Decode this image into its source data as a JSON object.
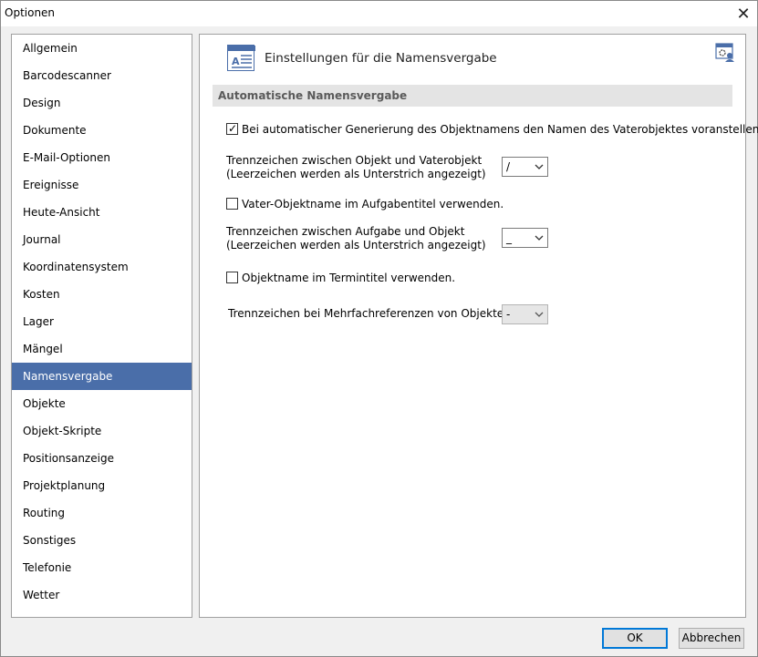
{
  "window": {
    "title": "Optionen",
    "close_label": "✕"
  },
  "sidebar": {
    "items": [
      {
        "label": "Allgemein",
        "selected": false
      },
      {
        "label": "Barcodescanner",
        "selected": false
      },
      {
        "label": "Design",
        "selected": false
      },
      {
        "label": "Dokumente",
        "selected": false
      },
      {
        "label": "E-Mail-Optionen",
        "selected": false
      },
      {
        "label": "Ereignisse",
        "selected": false
      },
      {
        "label": "Heute-Ansicht",
        "selected": false
      },
      {
        "label": "Journal",
        "selected": false
      },
      {
        "label": "Koordinatensystem",
        "selected": false
      },
      {
        "label": "Kosten",
        "selected": false
      },
      {
        "label": "Lager",
        "selected": false
      },
      {
        "label": "Mängel",
        "selected": false
      },
      {
        "label": "Namensvergabe",
        "selected": true
      },
      {
        "label": "Objekte",
        "selected": false
      },
      {
        "label": "Objekt-Skripte",
        "selected": false
      },
      {
        "label": "Positionsanzeige",
        "selected": false
      },
      {
        "label": "Projektplanung",
        "selected": false
      },
      {
        "label": "Routing",
        "selected": false
      },
      {
        "label": "Sonstiges",
        "selected": false
      },
      {
        "label": "Telefonie",
        "selected": false
      },
      {
        "label": "Wetter",
        "selected": false
      }
    ]
  },
  "content": {
    "header_title": "Einstellungen für die Namensvergabe",
    "header_icon": "settings-page-icon",
    "corner_icon": "user-settings-icon",
    "section_title": "Automatische Namensvergabe",
    "option_prepend_parent": {
      "label": "Bei automatischer Generierung des Objektnamens den Namen des Vaterobjektes voranstellen.",
      "checked": true
    },
    "separator_object_parent": {
      "line1": "Trennzeichen zwischen Objekt und Vaterobjekt",
      "line2": "(Leerzeichen werden als Unterstrich angezeigt)",
      "value": "/"
    },
    "option_parent_in_task": {
      "label": "Vater-Objektname im Aufgabentitel verwenden.",
      "checked": false
    },
    "separator_task_object": {
      "line1": "Trennzeichen zwischen Aufgabe und Objekt",
      "line2": "(Leerzeichen werden als Unterstrich angezeigt)",
      "value": "_"
    },
    "option_object_in_appointment": {
      "label": "Objektname im Termintitel verwenden.",
      "checked": false
    },
    "separator_multi_ref": {
      "label": "Trennzeichen bei Mehrfachreferenzen von Objekten",
      "value": "-",
      "disabled": true
    }
  },
  "footer": {
    "ok_label": "OK",
    "cancel_label": "Abbrechen"
  },
  "colors": {
    "selection": "#4a6ea9",
    "section_bar": "#e4e4e4",
    "default_button_border": "#0078d7"
  }
}
